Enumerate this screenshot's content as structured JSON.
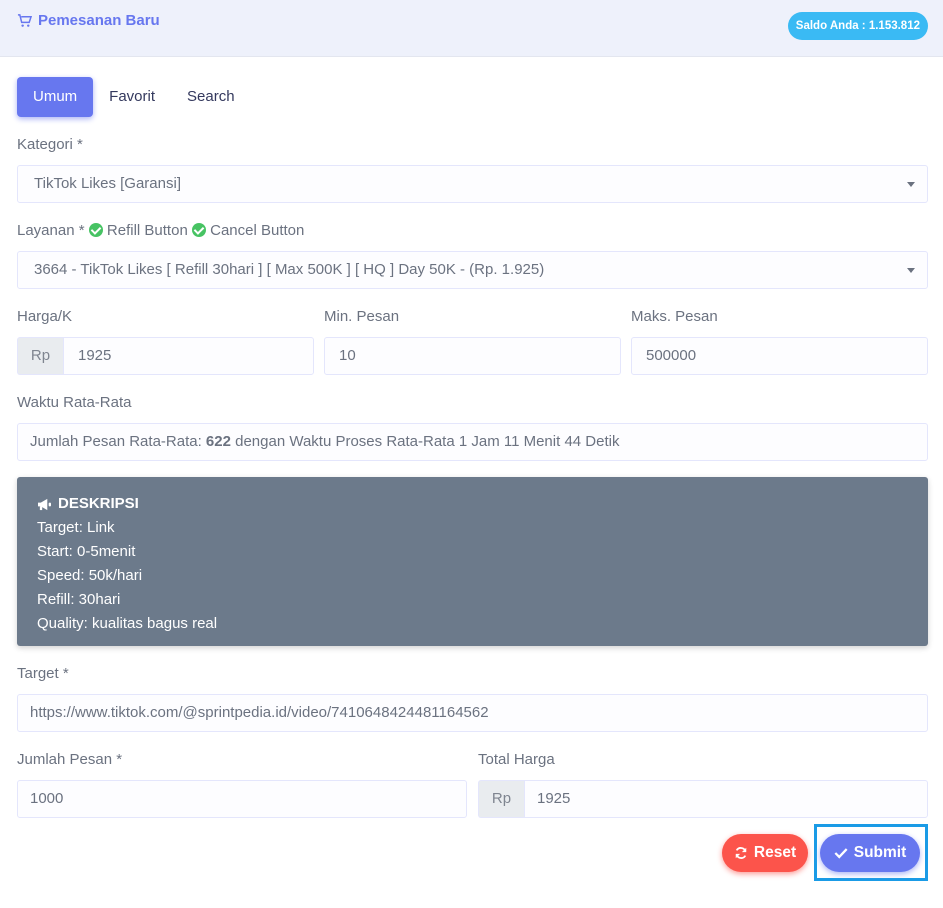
{
  "header": {
    "title": "Pemesanan Baru",
    "icon": "cart-icon",
    "saldo": "Saldo Anda : 1.153.812"
  },
  "tabs": [
    {
      "label": "Umum",
      "active": true
    },
    {
      "label": "Favorit"
    },
    {
      "label": "Search"
    }
  ],
  "form": {
    "kategori_label": "Kategori *",
    "kategori_value": "TikTok Likes [Garansi]",
    "layanan_label": "Layanan *",
    "refill_label": "Refill Button",
    "cancel_label": "Cancel Button",
    "layanan_value": "3664 - TikTok Likes [ Refill 30hari ] [ Max 500K ] [ HQ ] Day 50K - (Rp. 1.925)",
    "harga_label": "Harga/K",
    "harga_prefix": "Rp",
    "harga_value": "1925",
    "min_label": "Min. Pesan",
    "min_value": "10",
    "maks_label": "Maks. Pesan",
    "maks_value": "500000",
    "waktu_label": "Waktu Rata-Rata",
    "waktu_pre": "Jumlah Pesan Rata-Rata: ",
    "waktu_count": "622",
    "waktu_post": " dengan Waktu Proses Rata-Rata 1 Jam 11 Menit 44 Detik",
    "target_label": "Target *",
    "target_value": "https://www.tiktok.com/@sprintpedia.id/video/7410648424481164562",
    "jumlah_label": "Jumlah Pesan *",
    "jumlah_value": "1000",
    "total_label": "Total Harga",
    "total_prefix": "Rp",
    "total_value": "1925"
  },
  "deskripsi": {
    "title": "DESKRIPSI",
    "lines": [
      "Target: Link",
      "Start: 0-5menit",
      "Speed: 50k/hari",
      "Refill: 30hari",
      "Quality: kualitas bagus real"
    ]
  },
  "buttons": {
    "reset": "Reset",
    "submit": "Submit"
  },
  "colors": {
    "primary": "#6777ef",
    "danger": "#fc544b",
    "info": "#3abaf4",
    "success": "#47c363",
    "desc_bg": "#6c7a8b"
  }
}
